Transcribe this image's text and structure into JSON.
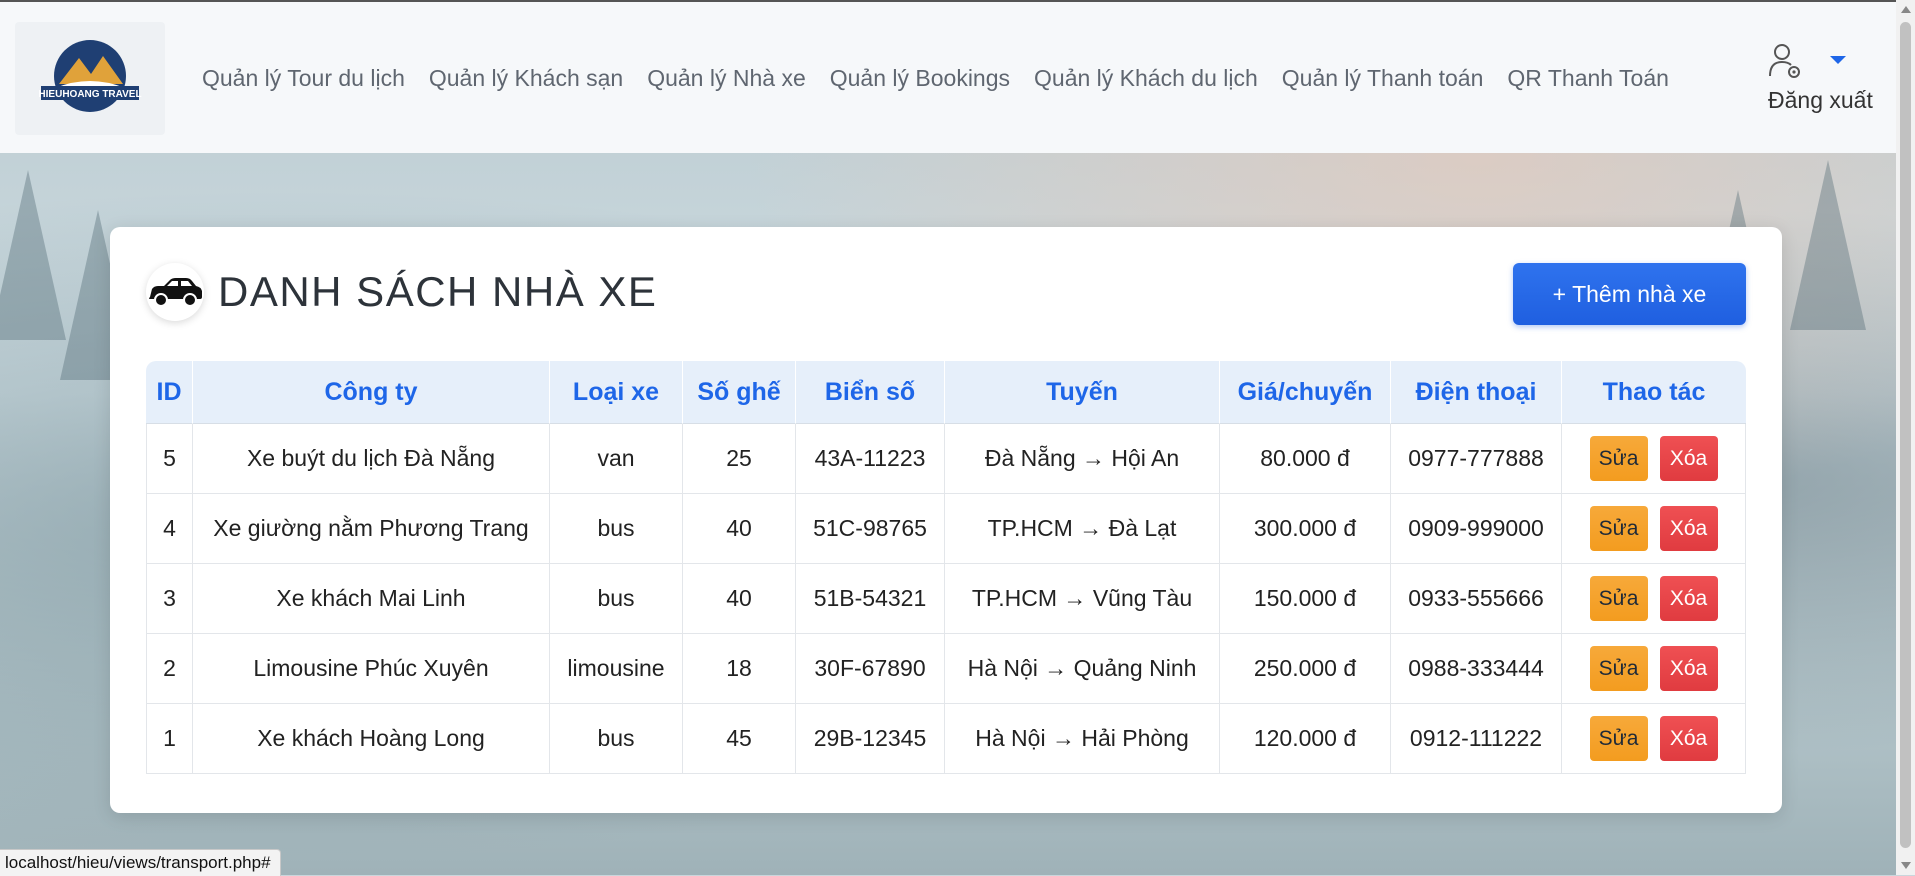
{
  "nav": {
    "logo_text": "HIEUHOANG TRAVEL",
    "links": [
      "Quản lý Tour du lịch",
      "Quản lý Khách sạn",
      "Quản lý Nhà xe",
      "Quản lý Bookings",
      "Quản lý Khách du lịch",
      "Quản lý Thanh toán",
      "QR Thanh Toán"
    ],
    "logout": "Đăng xuất"
  },
  "page": {
    "title": "DANH SÁCH NHÀ XE",
    "add_button": "+ Thêm nhà xe"
  },
  "table": {
    "headers": [
      "ID",
      "Công ty",
      "Loại xe",
      "Số ghế",
      "Biển số",
      "Tuyến",
      "Giá/chuyến",
      "Điện thoại",
      "Thao tác"
    ],
    "rows": [
      {
        "id": "5",
        "company": "Xe buýt du lịch Đà Nẵng",
        "type": "van",
        "seats": "25",
        "plate": "43A-11223",
        "route": "Đà Nẵng → Hội An",
        "price": "80.000 đ",
        "phone": "0977-777888"
      },
      {
        "id": "4",
        "company": "Xe giường nằm Phương Trang",
        "type": "bus",
        "seats": "40",
        "plate": "51C-98765",
        "route": "TP.HCM → Đà Lạt",
        "price": "300.000 đ",
        "phone": "0909-999000"
      },
      {
        "id": "3",
        "company": "Xe khách Mai Linh",
        "type": "bus",
        "seats": "40",
        "plate": "51B-54321",
        "route": "TP.HCM → Vũng Tàu",
        "price": "150.000 đ",
        "phone": "0933-555666"
      },
      {
        "id": "2",
        "company": "Limousine Phúc Xuyên",
        "type": "limousine",
        "seats": "18",
        "plate": "30F-67890",
        "route": "Hà Nội → Quảng Ninh",
        "price": "250.000 đ",
        "phone": "0988-333444"
      },
      {
        "id": "1",
        "company": "Xe khách Hoàng Long",
        "type": "bus",
        "seats": "45",
        "plate": "29B-12345",
        "route": "Hà Nội → Hải Phòng",
        "price": "120.000 đ",
        "phone": "0912-111222"
      }
    ],
    "edit_label": "Sửa",
    "delete_label": "Xóa"
  },
  "status_url": "localhost/hieu/views/transport.php#",
  "colors": {
    "accent": "#1e66e8",
    "edit": "#f39c1f",
    "delete": "#e03b40"
  }
}
